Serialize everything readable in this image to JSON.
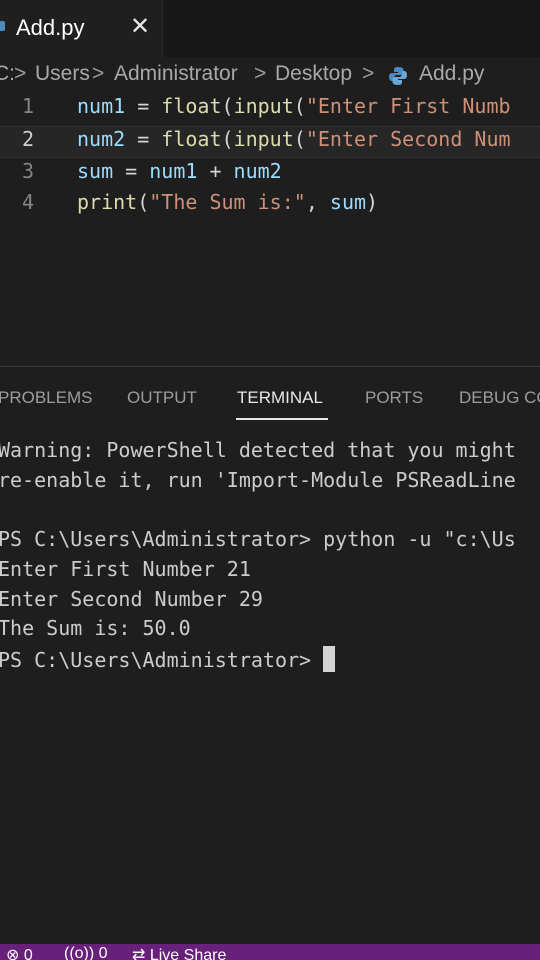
{
  "tab": {
    "filename": "Add.py",
    "close_glyph": "✕",
    "language_color": "#4b8bbe"
  },
  "breadcrumb": {
    "items": [
      "C:",
      "Users",
      "Administrator",
      "Desktop",
      "Add.py"
    ],
    "separator": ">"
  },
  "editor": {
    "lines": [
      {
        "num": "1",
        "tokens": [
          [
            "v",
            "num1"
          ],
          [
            "o",
            " = "
          ],
          [
            "f",
            "float"
          ],
          [
            "o",
            "("
          ],
          [
            "f",
            "input"
          ],
          [
            "o",
            "("
          ],
          [
            "s",
            "\"Enter First Numb"
          ]
        ]
      },
      {
        "num": "2",
        "tokens": [
          [
            "v",
            "num2"
          ],
          [
            "o",
            " = "
          ],
          [
            "f",
            "float"
          ],
          [
            "o",
            "("
          ],
          [
            "f",
            "input"
          ],
          [
            "o",
            "("
          ],
          [
            "s",
            "\"Enter Second Num"
          ]
        ]
      },
      {
        "num": "3",
        "tokens": [
          [
            "v",
            "sum"
          ],
          [
            "o",
            " = "
          ],
          [
            "v",
            "num1"
          ],
          [
            "o",
            " + "
          ],
          [
            "v",
            "num2"
          ]
        ]
      },
      {
        "num": "4",
        "tokens": [
          [
            "f",
            "print"
          ],
          [
            "o",
            "("
          ],
          [
            "s",
            "\"The Sum is:\""
          ],
          [
            "o",
            ", "
          ],
          [
            "v",
            "sum"
          ],
          [
            "o",
            ")"
          ]
        ]
      }
    ]
  },
  "panel": {
    "tabs": [
      {
        "label": "PROBLEMS",
        "active": false
      },
      {
        "label": "OUTPUT",
        "active": false
      },
      {
        "label": "TERMINAL",
        "active": true
      },
      {
        "label": "PORTS",
        "active": false
      },
      {
        "label": "DEBUG CO",
        "active": false
      }
    ]
  },
  "terminal": {
    "lines": [
      "Warning: PowerShell detected that you might",
      "re-enable it, run 'Import-Module PSReadLine",
      "",
      "PS C:\\Users\\Administrator> python -u \"c:\\Us",
      "Enter First Number 21",
      "Enter Second Number 29",
      "The Sum is: 50.0",
      "PS C:\\Users\\Administrator>"
    ]
  },
  "statusbar": {
    "color": "#68217a",
    "items": [
      "⊗ 0",
      "((o)) 0",
      "⇄ Live Share"
    ]
  }
}
